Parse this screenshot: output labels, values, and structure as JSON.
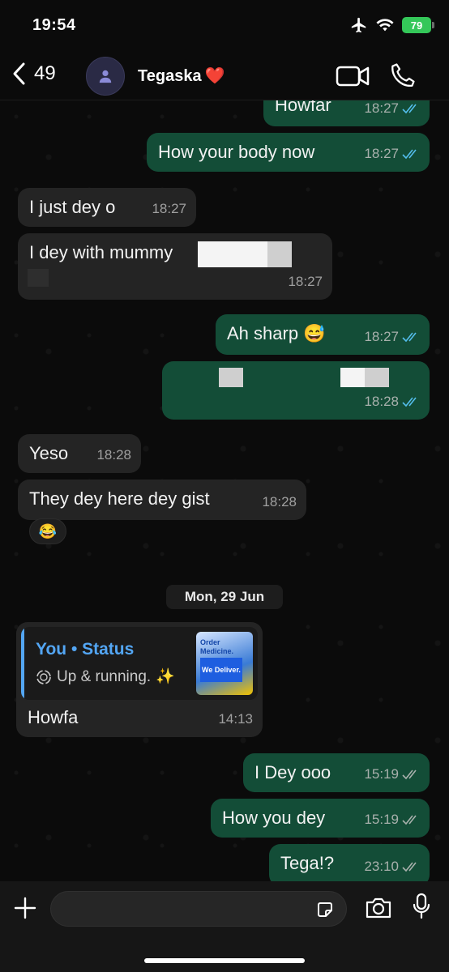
{
  "status_bar": {
    "time": "19:54",
    "battery": "79"
  },
  "header": {
    "back_count": "49",
    "contact_name": "Tegaska",
    "contact_emoji": "❤️"
  },
  "messages": [
    {
      "dir": "out",
      "text": "Howfar",
      "time": "18:27",
      "ticks": "read"
    },
    {
      "dir": "out",
      "text": "How your body now",
      "time": "18:27",
      "ticks": "read"
    },
    {
      "dir": "in",
      "text": "I just dey o",
      "time": "18:27"
    },
    {
      "dir": "in",
      "text": "I dey with mummy",
      "time": "18:27",
      "redacted": true
    },
    {
      "dir": "out",
      "text": "Ah sharp",
      "emoji": "😅",
      "time": "18:27",
      "ticks": "read"
    },
    {
      "dir": "out",
      "text": "",
      "time": "18:28",
      "ticks": "read",
      "redacted": true
    },
    {
      "dir": "in",
      "text": "Yeso",
      "time": "18:28"
    },
    {
      "dir": "in",
      "text": "They dey here dey gist",
      "time": "18:28",
      "reaction": "😂"
    },
    {
      "dir": "in",
      "text": "Howfa",
      "time": "14:13",
      "reply": {
        "title": "You • Status",
        "subtitle": "Up & running.",
        "subtitle_emoji": "✨",
        "thumb_line1": "Order Medicine.",
        "thumb_line2": "We Deliver."
      }
    },
    {
      "dir": "out",
      "text": "I Dey ooo",
      "time": "15:19",
      "ticks": "delivered"
    },
    {
      "dir": "out",
      "text": "How you dey",
      "time": "15:19",
      "ticks": "delivered"
    },
    {
      "dir": "out",
      "text": "Tega!?",
      "time": "23:10",
      "ticks": "delivered"
    }
  ],
  "date_separator": "Mon, 29 Jun",
  "composer": {
    "placeholder": ""
  },
  "icons": [
    "airplane-icon",
    "wifi-icon",
    "battery-icon",
    "back-chevron-icon",
    "person-icon",
    "video-call-icon",
    "phone-icon",
    "double-tick-icon",
    "plus-icon",
    "sticker-icon",
    "camera-icon",
    "microphone-icon"
  ],
  "colors": {
    "outgoing": "#134d37",
    "incoming": "#242424",
    "read_ticks": "#53bdeb",
    "accent_blue": "#53a6f4"
  }
}
